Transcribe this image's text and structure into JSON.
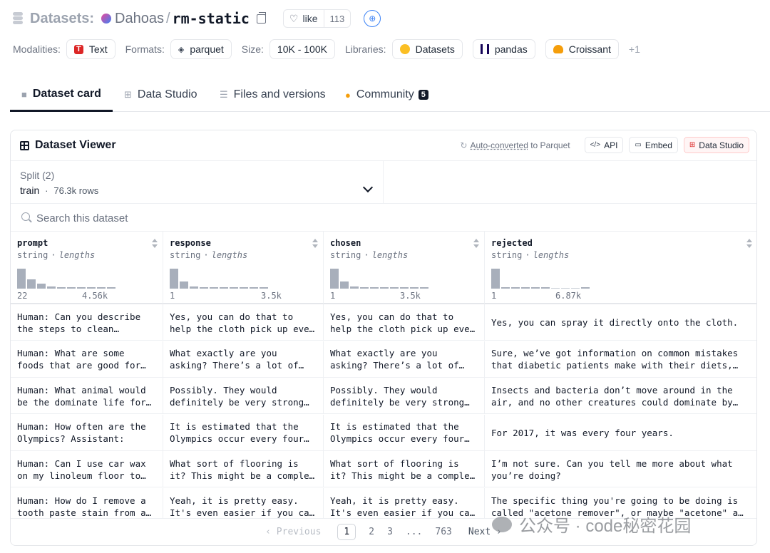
{
  "header": {
    "section_label": "Datasets:",
    "org": "Dahoas",
    "separator": "/",
    "repo": "rm-static",
    "like_label": "like",
    "like_count": "113"
  },
  "meta": {
    "modalities_label": "Modalities:",
    "modality": "Text",
    "formats_label": "Formats:",
    "format": "parquet",
    "size_label": "Size:",
    "size": "10K - 100K",
    "libraries_label": "Libraries:",
    "libraries": [
      "Datasets",
      "pandas",
      "Croissant"
    ],
    "more_libraries": "+1"
  },
  "tabs": [
    {
      "label": "Dataset card",
      "active": true
    },
    {
      "label": "Data Studio",
      "active": false
    },
    {
      "label": "Files and versions",
      "active": false
    },
    {
      "label": "Community",
      "active": false,
      "badge": "5"
    }
  ],
  "viewer": {
    "title": "Dataset Viewer",
    "auto_converted_link": "Auto-converted",
    "auto_converted_suffix": "to Parquet",
    "api_label": "API",
    "embed_label": "Embed",
    "data_studio_label": "Data Studio",
    "split_label": "Split (2)",
    "split_name": "train",
    "split_sep": "·",
    "split_rows": "76.3k rows",
    "search_placeholder": "Search this dataset"
  },
  "columns": [
    {
      "name": "prompt",
      "type": "string",
      "stat_sep": "·",
      "stat": "lengths",
      "min": "22",
      "max": "4.56k",
      "hist": [
        1.0,
        0.45,
        0.25,
        0.12,
        0.04,
        0.03,
        0.02,
        0.02,
        0.02,
        0.02
      ]
    },
    {
      "name": "response",
      "type": "string",
      "stat_sep": "·",
      "stat": "lengths",
      "min": "1",
      "max": "3.5k",
      "hist": [
        1.0,
        0.35,
        0.12,
        0.04,
        0.03,
        0.02,
        0.02,
        0.02,
        0.02,
        0.02
      ]
    },
    {
      "name": "chosen",
      "type": "string",
      "stat_sep": "·",
      "stat": "lengths",
      "min": "1",
      "max": "3.5k",
      "hist": [
        1.0,
        0.35,
        0.12,
        0.04,
        0.03,
        0.02,
        0.02,
        0.02,
        0.02,
        0.02
      ]
    },
    {
      "name": "rejected",
      "type": "string",
      "stat_sep": "·",
      "stat": "lengths",
      "min": "1",
      "max": "6.87k",
      "hist": [
        1.0,
        0.05,
        0.03,
        0.03,
        0.02,
        0.02,
        0.0,
        0.0,
        0.0,
        0.02
      ]
    }
  ],
  "rows": [
    [
      "Human: Can you describe the steps to clean…",
      "Yes, you can do that to help the cloth pick up eve…",
      "Yes, you can do that to help the cloth pick up eve…",
      "Yes, you can spray it directly onto the cloth."
    ],
    [
      "Human: What are some foods that are good for…",
      "What exactly are you asking? There’s a lot of…",
      "What exactly are you asking? There’s a lot of…",
      "Sure, we’ve got information on common mistakes that diabetic patients make with their diets,…"
    ],
    [
      "Human: What animal would be the dominate life for…",
      "Possibly. They would definitely be very strong…",
      "Possibly. They would definitely be very strong…",
      "Insects and bacteria don’t move around in the air, and no other creatures could dominate by…"
    ],
    [
      "Human: How often are the Olympics? Assistant:",
      "It is estimated that the Olympics occur every four…",
      "It is estimated that the Olympics occur every four…",
      "For 2017, it was every four years."
    ],
    [
      "Human: Can I use car wax on my linoleum floor to…",
      "What sort of flooring is it? This might be a comple…",
      "What sort of flooring is it? This might be a comple…",
      "I’m not sure. Can you tell me more about what you’re doing?"
    ],
    [
      "Human: How do I remove a tooth paste stain from a…",
      "Yeah, it is pretty easy. It's even easier if you ca…",
      "Yeah, it is pretty easy. It's even easier if you ca…",
      "The specific thing you're going to be doing is called \"acetone remover\", or maybe \"acetone\" a…"
    ]
  ],
  "pagination": {
    "prev": "‹ Previous",
    "pages": [
      "1",
      "2",
      "3",
      "...",
      "763"
    ],
    "current": "1",
    "next": "Next ›"
  },
  "watermark": "公众号 · code秘密花园"
}
